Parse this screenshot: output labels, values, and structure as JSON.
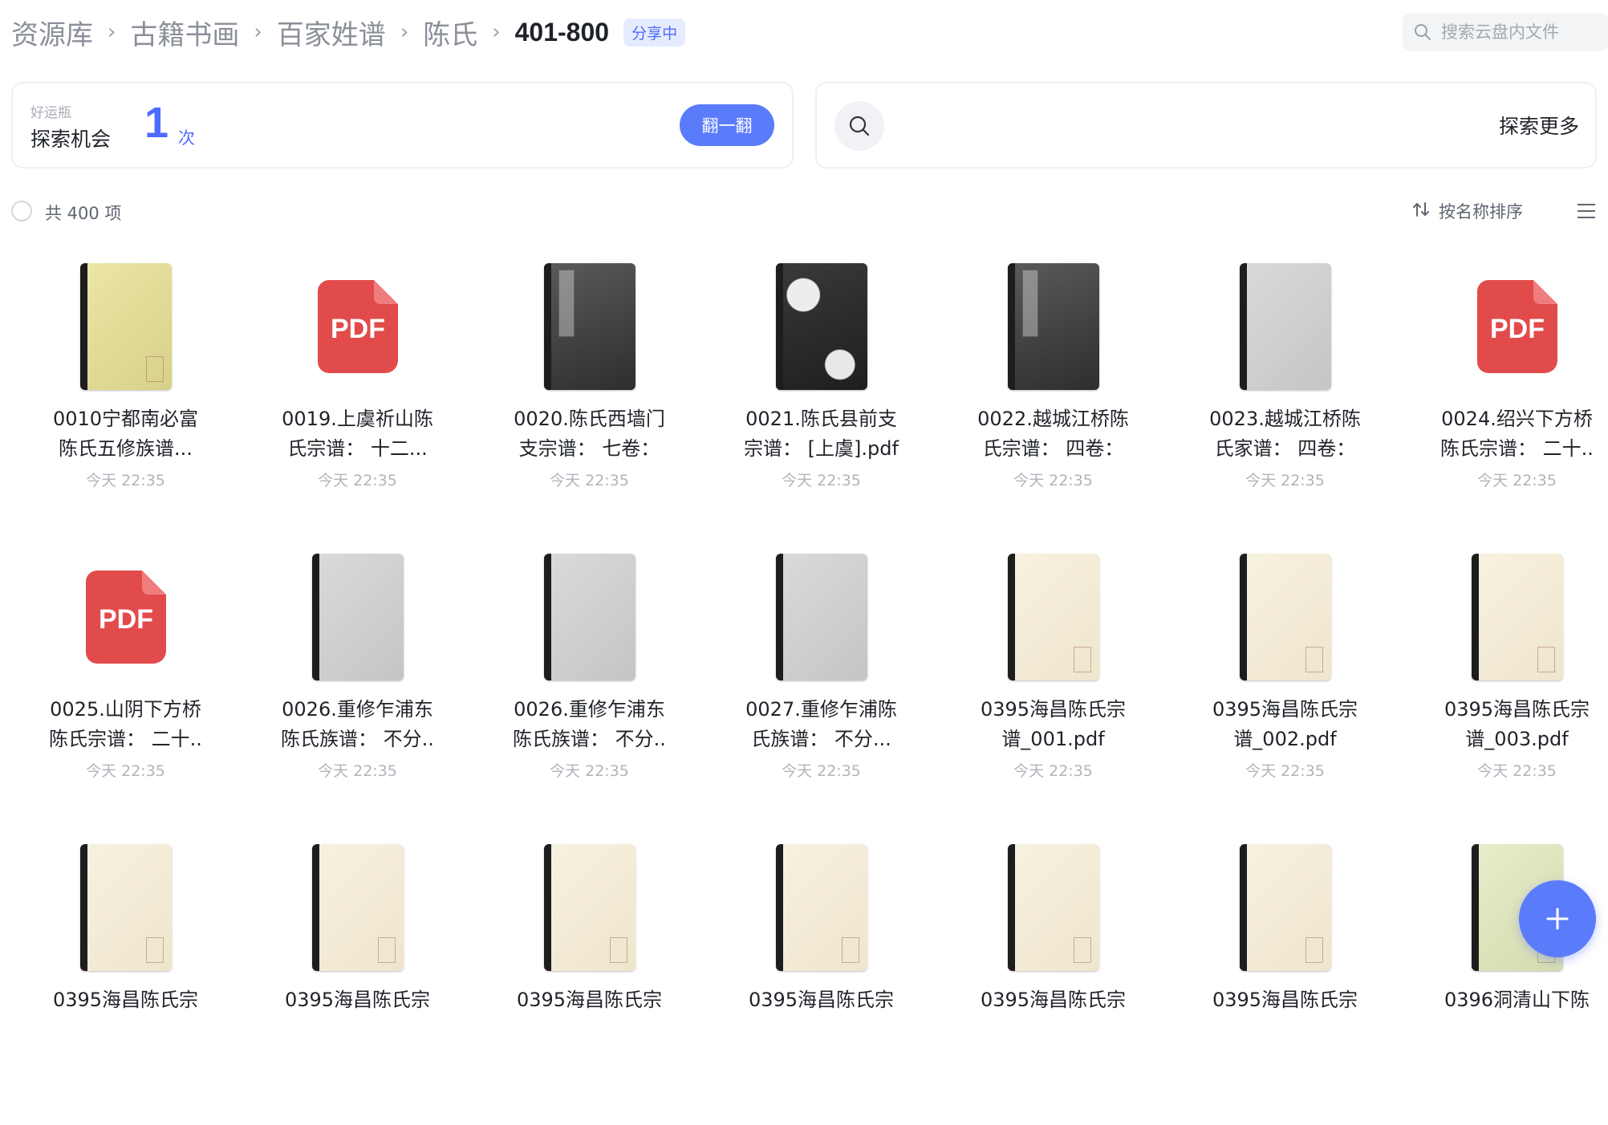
{
  "breadcrumb": {
    "items": [
      "资源库",
      "古籍书画",
      "百家姓谱",
      "陈氏"
    ],
    "current": "401-800",
    "separator": "›",
    "share_badge": "分享中"
  },
  "search": {
    "placeholder": "搜索云盘内文件",
    "value": ""
  },
  "lucky_card": {
    "title": "好运瓶",
    "label": "探索机会",
    "count": "1",
    "unit": "次",
    "button": "翻一翻"
  },
  "explore_card": {
    "label": "探索更多"
  },
  "toolbar": {
    "count_text": "共 400 项",
    "sort_label": "按名称排序"
  },
  "colors": {
    "accent": "#4d6bfe",
    "pdf_red": "#e24b4b"
  },
  "files": [
    {
      "name": "0010宁都南必富陈氏五修族谱...",
      "time": "今天 22:35",
      "thumb": "yellow"
    },
    {
      "name": "0019.上虞祈山陈氏宗谱： 十二...",
      "time": "今天 22:35",
      "thumb": "pdf",
      "pdf_text": "PDF"
    },
    {
      "name": "0020.陈氏西墙门支宗谱： 七卷： ..",
      "time": "今天 22:35",
      "thumb": "dark"
    },
    {
      "name": "0021.陈氏县前支宗谱： [上虞].pdf",
      "time": "今天 22:35",
      "thumb": "mottled"
    },
    {
      "name": "0022.越城江桥陈氏宗谱： 四卷： ..",
      "time": "今天 22:35",
      "thumb": "dark"
    },
    {
      "name": "0023.越城江桥陈氏家谱： 四卷： ..",
      "time": "今天 22:35",
      "thumb": "grey"
    },
    {
      "name": "0024.绍兴下方桥陈氏宗谱： 二十..",
      "time": "今天 22:35",
      "thumb": "pdf",
      "pdf_text": "PDF"
    },
    {
      "name": "0025.山阴下方桥陈氏宗谱： 二十..",
      "time": "今天 22:35",
      "thumb": "pdf",
      "pdf_text": "PDF"
    },
    {
      "name": "0026.重修乍浦东陈氏族谱： 不分..",
      "time": "今天 22:35",
      "thumb": "grey"
    },
    {
      "name": "0026.重修乍浦东陈氏族谱： 不分..",
      "time": "今天 22:35",
      "thumb": "grey"
    },
    {
      "name": "0027.重修乍浦陈氏族谱： 不分...",
      "time": "今天 22:35",
      "thumb": "grey"
    },
    {
      "name": "0395海昌陈氏宗谱_001.pdf",
      "time": "今天 22:35",
      "thumb": "cream"
    },
    {
      "name": "0395海昌陈氏宗谱_002.pdf",
      "time": "今天 22:35",
      "thumb": "cream"
    },
    {
      "name": "0395海昌陈氏宗谱_003.pdf",
      "time": "今天 22:35",
      "thumb": "cream"
    },
    {
      "name": "0395海昌陈氏宗",
      "time": "",
      "thumb": "cream"
    },
    {
      "name": "0395海昌陈氏宗",
      "time": "",
      "thumb": "cream"
    },
    {
      "name": "0395海昌陈氏宗",
      "time": "",
      "thumb": "cream"
    },
    {
      "name": "0395海昌陈氏宗",
      "time": "",
      "thumb": "cream"
    },
    {
      "name": "0395海昌陈氏宗",
      "time": "",
      "thumb": "cream"
    },
    {
      "name": "0395海昌陈氏宗",
      "time": "",
      "thumb": "cream"
    },
    {
      "name": "0396洞清山下陈",
      "time": "",
      "thumb": "green"
    }
  ]
}
